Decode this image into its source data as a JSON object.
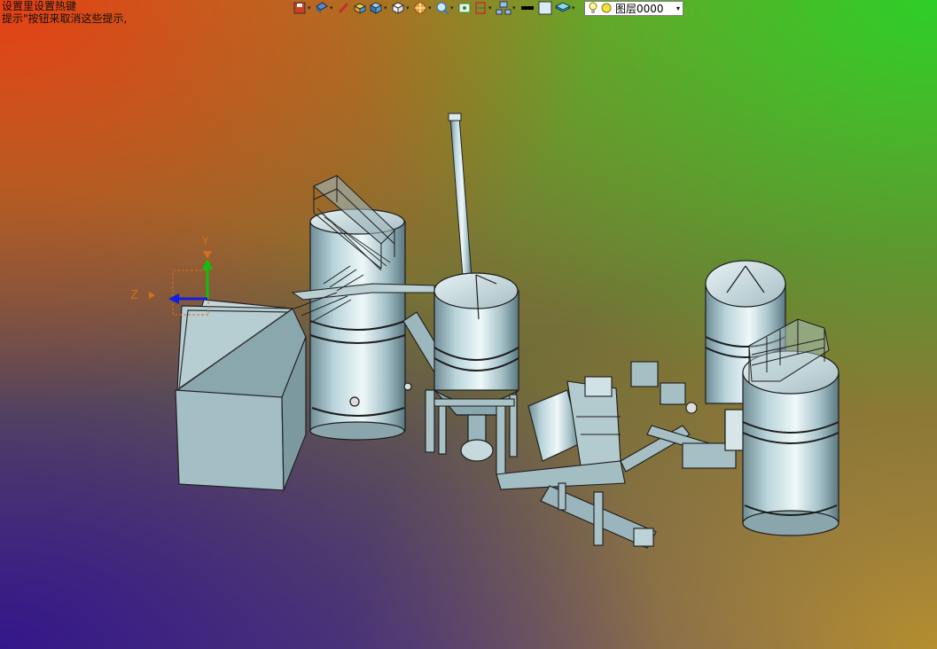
{
  "hint": {
    "line1": "设置里设置热键",
    "line2": "提示\"按钮来取消这些提示,"
  },
  "toolbar": {
    "icons": [
      "save-view-icon",
      "render-mode-icon",
      "pen-icon",
      "box-view-icon",
      "iso-cube-icon",
      "white-cube-icon",
      "sun-icon",
      "zoom-icon",
      "fit-view-icon",
      "section-icon",
      "network-icon",
      "line-color-icon",
      "fill-color-icon",
      "layer-stack-icon",
      "lightbulb-icon",
      "layer-status-icon"
    ],
    "layer_value": "图层0000",
    "layer_dropdown": "▾"
  },
  "triad": {
    "x_label": "Y",
    "z_label": "Z"
  }
}
